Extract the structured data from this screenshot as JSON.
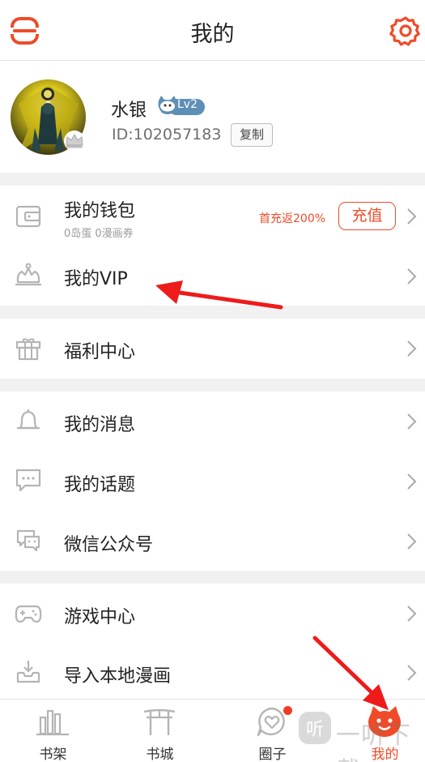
{
  "header": {
    "title": "我的",
    "menu_icon": "menu-icon",
    "settings_icon": "gear-icon"
  },
  "profile": {
    "username": "水银",
    "level": "Lv2",
    "user_id": "ID:102057183",
    "copy_label": "复制"
  },
  "wallet": {
    "label": "我的钱包",
    "subtitle": "0岛蛋 0漫画券",
    "promo": "首充返200%",
    "recharge_label": "充值"
  },
  "menu": {
    "vip": "我的VIP",
    "welfare": "福利中心",
    "messages": "我的消息",
    "topics": "我的话题",
    "wechat": "微信公众号",
    "games": "游戏中心",
    "import": "导入本地漫画"
  },
  "tabs": [
    {
      "label": "书架",
      "icon": "bookshelf-icon"
    },
    {
      "label": "书城",
      "icon": "bookstore-icon"
    },
    {
      "label": "圈子",
      "icon": "circle-icon"
    },
    {
      "label": "我的",
      "icon": "cat-face-icon"
    }
  ],
  "watermark": {
    "text": "一听下载"
  },
  "colors": {
    "accent": "#ef4b28",
    "icon_gray": "#b4b4b4",
    "annotation_red": "#ee1b1b"
  }
}
